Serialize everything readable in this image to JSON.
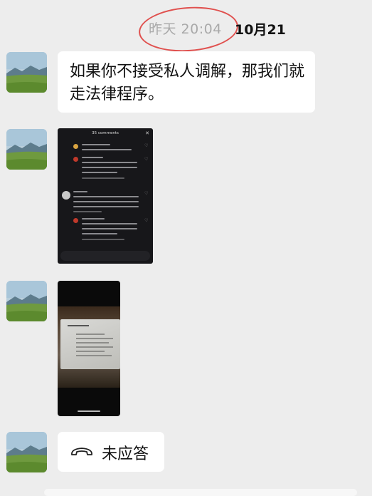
{
  "timestamp": {
    "time": "昨天 20:04",
    "date": "10月21"
  },
  "messages": {
    "text1": "如果你不接受私人调解，那我们就走法律程序。",
    "call_label": "未应答"
  },
  "comments_screenshot": {
    "header": "35 comments"
  },
  "icons": {
    "avatar": "landscape-avatar",
    "call": "missed-call-icon",
    "close": "close-icon",
    "heart": "heart-icon"
  },
  "colors": {
    "annotation_circle": "#e0504e",
    "background": "#ededed"
  }
}
